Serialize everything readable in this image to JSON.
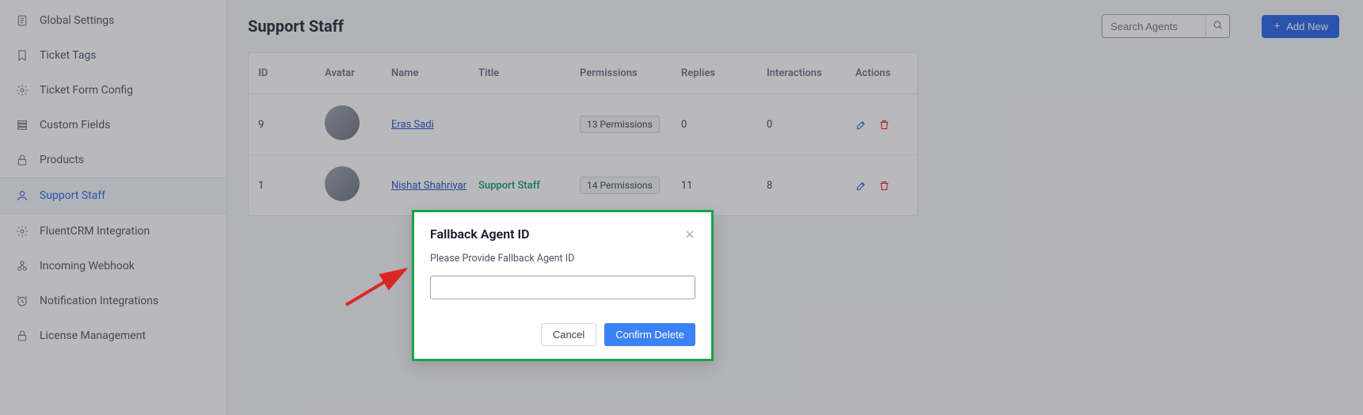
{
  "sidebar": {
    "items": [
      {
        "label": "Global Settings",
        "icon": "file-text-icon"
      },
      {
        "label": "Ticket Tags",
        "icon": "bookmark-icon"
      },
      {
        "label": "Ticket Form Config",
        "icon": "gear-icon"
      },
      {
        "label": "Custom Fields",
        "icon": "fields-icon"
      },
      {
        "label": "Products",
        "icon": "lock-icon"
      },
      {
        "label": "Support Staff",
        "icon": "user-icon",
        "active": true
      },
      {
        "label": "FluentCRM Integration",
        "icon": "gear-icon"
      },
      {
        "label": "Incoming Webhook",
        "icon": "webhook-icon"
      },
      {
        "label": "Notification Integrations",
        "icon": "clock-icon"
      },
      {
        "label": "License Management",
        "icon": "lock-icon"
      }
    ]
  },
  "header": {
    "title": "Support Staff",
    "search_placeholder": "Search Agents",
    "add_label": "Add New"
  },
  "table": {
    "columns": [
      "ID",
      "Avatar",
      "Name",
      "Title",
      "Permissions",
      "Replies",
      "Interactions",
      "Actions"
    ],
    "rows": [
      {
        "id": "9",
        "name": "Eras Sadi",
        "title": "",
        "permissions": "13 Permissions",
        "replies": "0",
        "interactions": "0"
      },
      {
        "id": "1",
        "name": "Nishat Shahriyar",
        "title": "Support Staff",
        "permissions": "14 Permissions",
        "replies": "11",
        "interactions": "8"
      }
    ]
  },
  "modal": {
    "title": "Fallback Agent ID",
    "label": "Please Provide Fallback Agent ID",
    "cancel": "Cancel",
    "confirm": "Confirm Delete"
  }
}
